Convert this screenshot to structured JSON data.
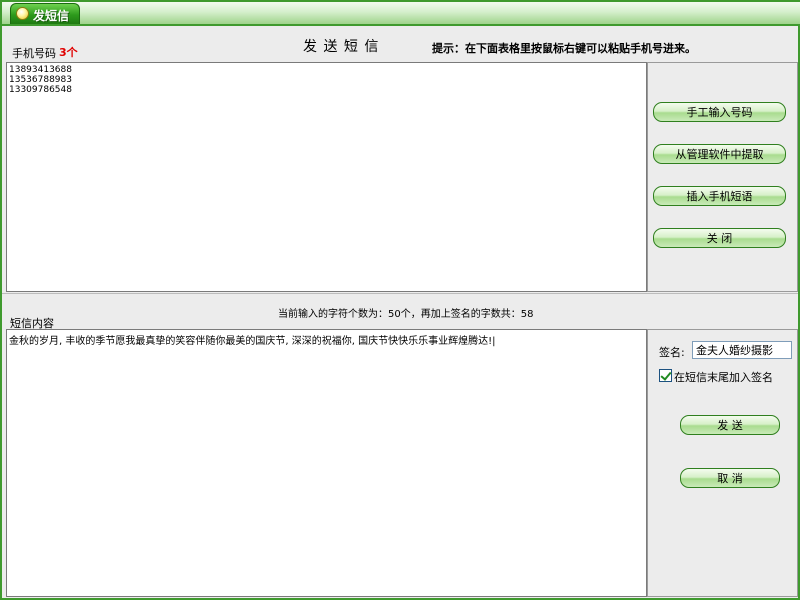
{
  "window": {
    "title": "发短信"
  },
  "top": {
    "label": "手机号码",
    "count": "3个",
    "heading": "发 送 短 信",
    "hint": "提示：在下面表格里按鼠标右键可以粘贴手机号进来。",
    "phones": [
      "13893413688",
      "13536788983",
      "13309786548"
    ]
  },
  "side_buttons": {
    "manual": "手工输入号码",
    "extract": "从管理软件中提取",
    "insert": "插入手机短语",
    "close": "关 闭"
  },
  "middle": {
    "count_text": "当前输入的字符个数为：50个，再加上签名的字数共：58",
    "label": "短信内容"
  },
  "message": {
    "text": "金秋的岁月, 丰收的季节愿我最真挚的笑容伴随你最美的国庆节, 深深的祝福你, 国庆节快快乐乐事业辉煌腾达!|"
  },
  "signature": {
    "label": "签名:",
    "value": "金夫人婚纱摄影",
    "checkbox_label": "在短信末尾加入签名",
    "checked": true
  },
  "actions": {
    "send": "发 送",
    "cancel": "取 消"
  }
}
